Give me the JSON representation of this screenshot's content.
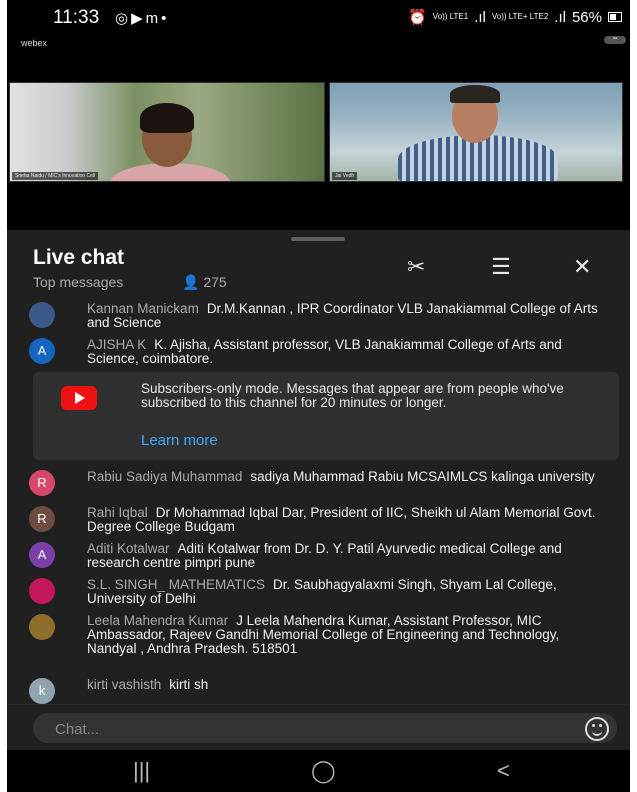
{
  "status_bar": {
    "time": "11:33",
    "icons": [
      "whatsapp-icon",
      "youtube-icon",
      "gmail-icon",
      "dot-icon"
    ],
    "signal1": "Vo)) LTE1",
    "signal2": "Vo)) LTE+ LTE2",
    "battery": "56%"
  },
  "video": {
    "app_logo": "webex",
    "participants": [
      {
        "name": "Sneha Naidu / MIC's Innovation Cell"
      },
      {
        "name": "Jai Vedh"
      }
    ]
  },
  "chat": {
    "title": "Live chat",
    "mode": "Top messages",
    "viewer_count": "275",
    "icons": {
      "clip": "scissors-icon",
      "settings": "tune-icon",
      "close": "close-icon"
    },
    "subscribers_notice": {
      "text": "Subscribers-only mode. Messages that appear are from people who've subscribed to this channel for 20 minutes or longer.",
      "link": "Learn more"
    },
    "messages": [
      {
        "author": "Kannan Manickam",
        "text": "Dr.M.Kannan , IPR Coordinator VLB Janakiammal College of Arts and Science",
        "avatar": "photo",
        "color": "#3a5a8c"
      },
      {
        "author": "AJISHA K",
        "text": "K. Ajisha, Assistant professor, VLB Janakiammal College of Arts and Science, coimbatore.",
        "avatar": "A",
        "color": "#1565c0"
      },
      {
        "author": "Rabiu Sadiya Muhammad",
        "text": "sadiya Muhammad Rabiu MCSAIMLCS kalinga university",
        "avatar": "R",
        "color": "#d6476b"
      },
      {
        "author": "Rahi Iqbal",
        "text": "Dr Mohammad Iqbal Dar, President of IIC, Sheikh ul Alam Memorial Govt. Degree College Budgam",
        "avatar": "R",
        "color": "#6d4c41"
      },
      {
        "author": "Aditi Kotalwar",
        "text": "Aditi Kotalwar from Dr. D. Y. Patil Ayurvedic medical College and research centre pimpri pune",
        "avatar": "A",
        "color": "#7b3fa8"
      },
      {
        "author": "S.L. SINGH_ MATHEMATICS",
        "text": "Dr. Saubhagyalaxmi Singh, Shyam Lal College, University of Delhi",
        "avatar": "photo",
        "color": "#c2185b"
      },
      {
        "author": "Leela Mahendra Kumar",
        "text": "J Leela Mahendra Kumar, Assistant Professor, MIC Ambassador, Rajeev Gandhi Memorial College of Engineering and Technology, Nandyal , Andhra Pradesh. 518501",
        "avatar": "photo",
        "color": "#8d6e2a"
      },
      {
        "author": "kirti vashisth",
        "text": "kirti sh",
        "avatar": "k",
        "color": "#90a4ae"
      }
    ],
    "input_placeholder": "Chat..."
  },
  "nav": {
    "recent": "|||",
    "home": "◯",
    "back": "<"
  }
}
